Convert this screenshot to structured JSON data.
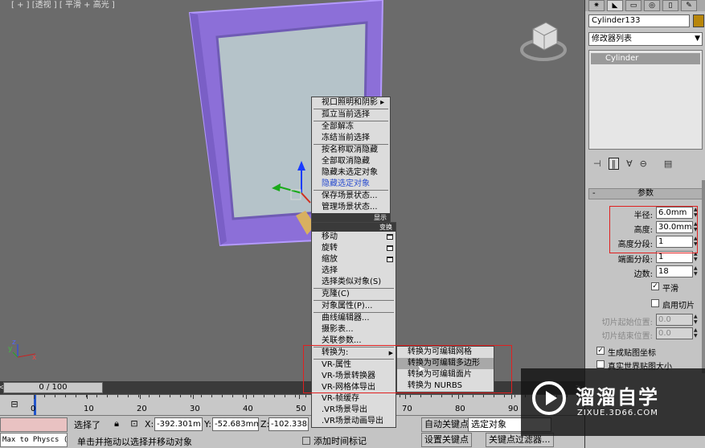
{
  "viewport": {
    "label": "[ + ] [透视 ] [ 平滑 + 高光 ]"
  },
  "command_panel": {
    "object_name": "Cylinder133",
    "object_color": "#b8860b",
    "modifier_list": "修改器列表",
    "stack_items": [
      "Cylinder"
    ],
    "rollout_title": "参数",
    "params": [
      {
        "label": "半径:",
        "value": "6.0mm"
      },
      {
        "label": "高度:",
        "value": "30.0mm"
      },
      {
        "label": "高度分段:",
        "value": "1"
      },
      {
        "label": "端面分段:",
        "value": "1"
      },
      {
        "label": "边数:",
        "value": "18"
      }
    ],
    "smooth_label": "平滑",
    "slice_on_label": "启用切片",
    "slice_from_label": "切片起始位置:",
    "slice_from_value": "0.0",
    "slice_to_label": "切片结束位置:",
    "slice_to_value": "0.0",
    "gen_map_label": "生成贴图坐标",
    "real_world_label": "真实世界贴图大小"
  },
  "quad_menu": {
    "top_header": "显示",
    "top_items": [
      {
        "label": "视口照明和阴影 ▸",
        "submenu": true
      },
      {
        "label": "孤立当前选择"
      },
      {
        "label": "全部解冻"
      },
      {
        "label": "冻结当前选择"
      },
      {
        "label": "按名称取消隐藏"
      },
      {
        "label": "全部取消隐藏"
      },
      {
        "label": "隐藏未选定对象"
      },
      {
        "label": "隐藏选定对象"
      },
      {
        "label": "保存场景状态..."
      },
      {
        "label": "管理场景状态..."
      }
    ],
    "bottom_header": "变换",
    "bottom_items": [
      {
        "label": "移动"
      },
      {
        "label": "旋转"
      },
      {
        "label": "缩放"
      },
      {
        "label": "选择"
      },
      {
        "label": "选择类似对象(S)"
      },
      {
        "label": "克隆(C)"
      },
      {
        "label": "对象属性(P)..."
      },
      {
        "label": "曲线编辑器..."
      },
      {
        "label": "摄影表..."
      },
      {
        "label": "关联参数..."
      },
      {
        "label": "转换为:"
      },
      {
        "label": "VR-属性"
      },
      {
        "label": "VR-场景转换器"
      },
      {
        "label": "VR-网格体导出"
      },
      {
        "label": "VR-帧缓存"
      },
      {
        "label": ".VR场景导出"
      },
      {
        "label": ".VR场景动画导出"
      }
    ],
    "convert_submenu": [
      "转换为可编辑网格",
      "转换为可编辑多边形",
      "转换为可编辑面片",
      "转换为 NURBS"
    ]
  },
  "timeline": {
    "slider_label": "0 / 100",
    "ticks": [
      "0",
      "10",
      "20",
      "30",
      "40",
      "50",
      "60",
      "70",
      "80",
      "90"
    ]
  },
  "status": {
    "listener_text": "Max to Physcs (",
    "selection": "选择了",
    "x_label": "X:",
    "x_value": "-392.301m",
    "y_label": "Y:",
    "y_value": "-52.683mm",
    "z_label": "Z:",
    "z_value": "-102.338m",
    "prompt": "单击并拖动以选择并移动对象",
    "add_time_tag": "添加时间标记",
    "auto_key": "自动关键点",
    "set_key": "设置关键点",
    "selected_object": "选定对象",
    "key_filters": "关键点过滤器..."
  },
  "watermark": {
    "title": "溜溜自学",
    "url": "ZIXUE.3D66.COM"
  }
}
